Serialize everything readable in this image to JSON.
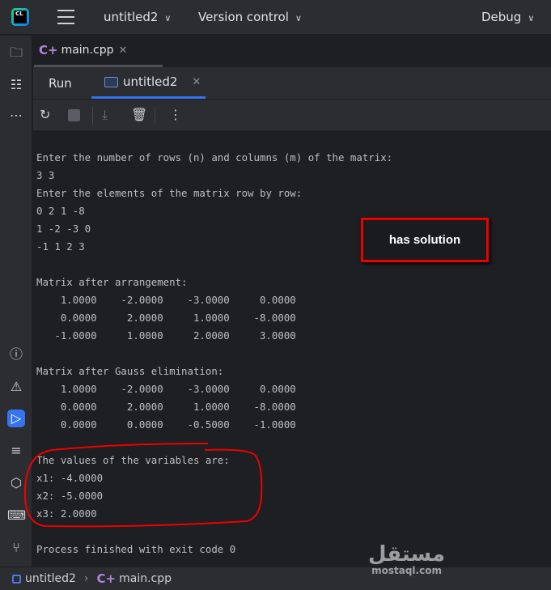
{
  "topbar": {
    "project": "untitled2",
    "vcs": "Version control",
    "config": "Debug",
    "logo": "CL"
  },
  "file_tab": {
    "name": "main.cpp"
  },
  "run_panel": {
    "label": "Run",
    "tab": "untitled2"
  },
  "console": {
    "lines": [
      "Enter the number of rows (n) and columns (m) of the matrix:",
      "3 3",
      "Enter the elements of the matrix row by row:",
      "0 2 1 -8",
      "1 -2 -3 0",
      "-1 1 2 3",
      "",
      "Matrix after arrangement:",
      "    1.0000    -2.0000    -3.0000     0.0000",
      "    0.0000     2.0000     1.0000    -8.0000",
      "   -1.0000     1.0000     2.0000     3.0000",
      "",
      "Matrix after Gauss elimination:",
      "    1.0000    -2.0000    -3.0000     0.0000",
      "    0.0000     2.0000     1.0000    -8.0000",
      "    0.0000     0.0000    -0.5000    -1.0000",
      "",
      "The values of the variables are:",
      "x1: -4.0000",
      "x2: -5.0000",
      "x3: 2.0000",
      "",
      "Process finished with exit code 0"
    ]
  },
  "annotation": {
    "text": "has solution"
  },
  "statusbar": {
    "project": "untitled2",
    "file": "main.cpp"
  },
  "watermark": {
    "arabic": "مستقل",
    "latin": "mostaql.com"
  }
}
